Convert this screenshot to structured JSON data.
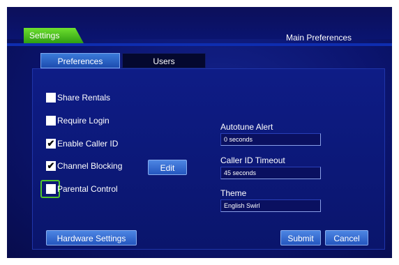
{
  "header": {
    "settings_tab": "Settings",
    "page_title": "Main Preferences"
  },
  "tabs": [
    {
      "label": "Preferences",
      "active": true
    },
    {
      "label": "Users",
      "active": false
    }
  ],
  "checkboxes": [
    {
      "label": "Share Rentals",
      "checked": false
    },
    {
      "label": "Require Login",
      "checked": false
    },
    {
      "label": "Enable Caller ID",
      "checked": true
    },
    {
      "label": "Channel Blocking",
      "checked": true
    },
    {
      "label": "Parental Control",
      "checked": false,
      "focused": true
    }
  ],
  "edit_button": "Edit",
  "fields": [
    {
      "label": "Autotune Alert",
      "value": "0 seconds"
    },
    {
      "label": "Caller ID Timeout",
      "value": "45 seconds"
    },
    {
      "label": "Theme",
      "value": "English Swirl"
    }
  ],
  "buttons": {
    "hardware": "Hardware Settings",
    "submit": "Submit",
    "cancel": "Cancel"
  },
  "colors": {
    "background": "#0b146e",
    "accent_green": "#52c82a",
    "button_blue": "#2456bf"
  }
}
